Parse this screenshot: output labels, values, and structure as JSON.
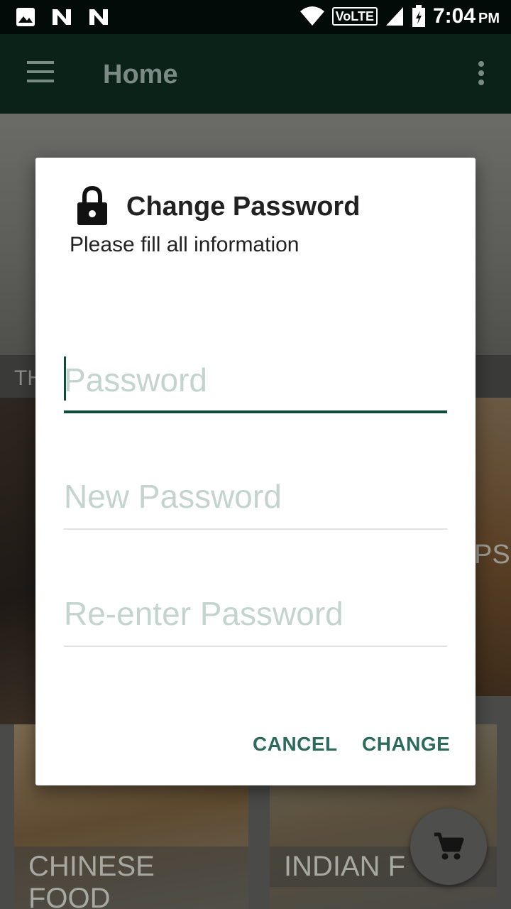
{
  "status_bar": {
    "left_icons": [
      "image-icon",
      "n-notification-icon",
      "n-notification-icon"
    ],
    "right_icons": [
      "wifi-icon",
      "volte-icon",
      "cell-signal-icon",
      "battery-icon"
    ],
    "volte_label": "VoLTE",
    "time": "7:04",
    "ampm": "PM"
  },
  "toolbar": {
    "title": "Home",
    "menu_icon": "hamburger-menu-icon",
    "overflow_icon": "more-vert-icon"
  },
  "background": {
    "section_label": "TH",
    "tile_right_label": "PS",
    "tiles": [
      {
        "label": "CHINESE FOOD"
      },
      {
        "label": "INDIAN F"
      }
    ],
    "fab_icon": "cart-icon"
  },
  "dialog": {
    "icon": "lock-icon",
    "title": "Change Password",
    "subtitle": "Please fill all information",
    "fields": [
      {
        "placeholder": "Password",
        "value": "",
        "focused": true
      },
      {
        "placeholder": "New Password",
        "value": "",
        "focused": false
      },
      {
        "placeholder": "Re-enter Password",
        "value": "",
        "focused": false
      }
    ],
    "cancel_label": "CANCEL",
    "change_label": "CHANGE"
  },
  "colors": {
    "accent": "#2c6b5c",
    "toolbar": "#0b2219",
    "status_bar": "#030b08",
    "placeholder": "#c3d4cf"
  }
}
